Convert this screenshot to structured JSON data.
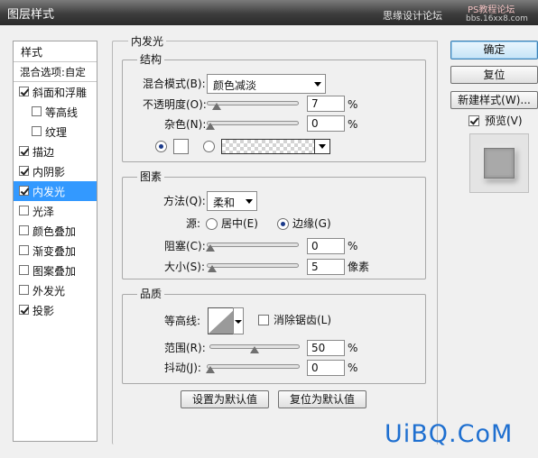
{
  "window": {
    "title": "图层样式",
    "watermark_line1": "思缘设计论坛",
    "watermark_line2": "PS教程论坛",
    "watermark_line3": "bbs.16xx8.com"
  },
  "styles_panel": {
    "header": "样式",
    "blend_options": "混合选项:自定",
    "items": [
      {
        "label": "斜面和浮雕",
        "checked": true,
        "indent": false,
        "selected": false
      },
      {
        "label": "等高线",
        "checked": false,
        "indent": true,
        "selected": false
      },
      {
        "label": "纹理",
        "checked": false,
        "indent": true,
        "selected": false
      },
      {
        "label": "描边",
        "checked": true,
        "indent": false,
        "selected": false
      },
      {
        "label": "内阴影",
        "checked": true,
        "indent": false,
        "selected": false
      },
      {
        "label": "内发光",
        "checked": true,
        "indent": false,
        "selected": true
      },
      {
        "label": "光泽",
        "checked": false,
        "indent": false,
        "selected": false
      },
      {
        "label": "颜色叠加",
        "checked": false,
        "indent": false,
        "selected": false
      },
      {
        "label": "渐变叠加",
        "checked": false,
        "indent": false,
        "selected": false
      },
      {
        "label": "图案叠加",
        "checked": false,
        "indent": false,
        "selected": false
      },
      {
        "label": "外发光",
        "checked": false,
        "indent": false,
        "selected": false
      },
      {
        "label": "投影",
        "checked": true,
        "indent": false,
        "selected": false
      }
    ]
  },
  "inner_glow": {
    "section_title": "内发光",
    "structure": {
      "title": "结构",
      "blend_mode_label": "混合模式(B):",
      "blend_mode_value": "颜色减淡",
      "opacity_label": "不透明度(O):",
      "opacity_value": "7",
      "opacity_fraction": 0.07,
      "opacity_unit": "%",
      "noise_label": "杂色(N):",
      "noise_value": "0",
      "noise_fraction": 0.0,
      "noise_unit": "%",
      "color_mode": "solid",
      "glow_color": "#ffffff"
    },
    "elements": {
      "title": "图素",
      "technique_label": "方法(Q):",
      "technique_value": "柔和",
      "source_label": "源:",
      "source_center": "居中(E)",
      "source_edge": "边缘(G)",
      "source_selected": "edge",
      "choke_label": "阻塞(C):",
      "choke_value": "0",
      "choke_fraction": 0.0,
      "choke_unit": "%",
      "size_label": "大小(S):",
      "size_value": "5",
      "size_fraction": 0.02,
      "size_unit": "像素"
    },
    "quality": {
      "title": "品质",
      "contour_label": "等高线:",
      "anti_alias_label": "消除锯齿(L)",
      "anti_alias_checked": false,
      "range_label": "范围(R):",
      "range_value": "50",
      "range_fraction": 0.5,
      "range_unit": "%",
      "jitter_label": "抖动(J):",
      "jitter_value": "0",
      "jitter_fraction": 0.0,
      "jitter_unit": "%"
    },
    "set_default_button": "设置为默认值",
    "reset_default_button": "复位为默认值"
  },
  "right_panel": {
    "ok_button": "确定",
    "reset_button": "复位",
    "new_style_button": "新建样式(W)...",
    "preview_label": "预览(V)",
    "preview_checked": true
  },
  "logo_text": "UiBQ.CoM",
  "colors": {
    "selected_item": "#3399ff",
    "logo": "#1e6fd0"
  }
}
